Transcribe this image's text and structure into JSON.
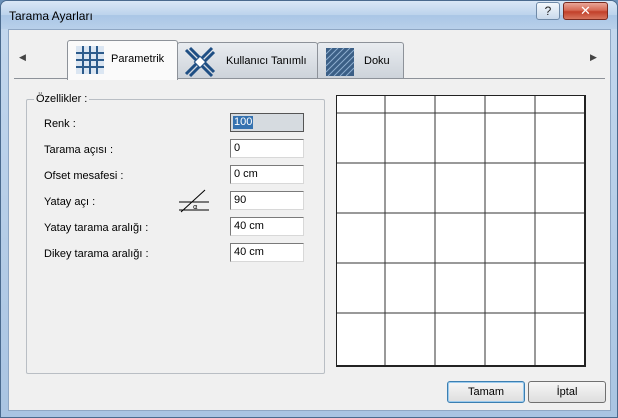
{
  "window": {
    "title": "Tarama Ayarları",
    "help_symbol": "?",
    "close_symbol": "✕"
  },
  "tabs": [
    {
      "label": "Parametrik",
      "icon": "grid-hatch-icon",
      "active": true
    },
    {
      "label": "Kullanıcı Tanımlı",
      "icon": "cross-hatch-icon",
      "active": false
    },
    {
      "label": "Doku",
      "icon": "texture-icon",
      "active": false
    }
  ],
  "tab_scroll": {
    "left": "◀",
    "right": "▶"
  },
  "properties": {
    "legend": "Özellikler :",
    "renk_label": "Renk :",
    "renk_value": "100",
    "tarama_acisi_label": "Tarama açısı :",
    "tarama_acisi_value": "0",
    "ofset_label": "Ofset mesafesi :",
    "ofset_value": "0 cm",
    "yatay_aci_label": "Yatay açı :",
    "yatay_aci_value": "90",
    "yatay_aralik_label": "Yatay tarama aralığı :",
    "yatay_aralik_value": "40 cm",
    "dikey_aralik_label": "Dikey tarama aralığı :",
    "dikey_aralik_value": "40 cm",
    "angle_icon_text": "α"
  },
  "preview": {
    "description_icon": "hatch-preview",
    "columns": 5,
    "rows": 5
  },
  "buttons": {
    "ok": "Tamam",
    "cancel": "İptal"
  },
  "colors": {
    "accent": "#3572b0",
    "close": "#c2402a",
    "frame": "#a9c4e2"
  }
}
